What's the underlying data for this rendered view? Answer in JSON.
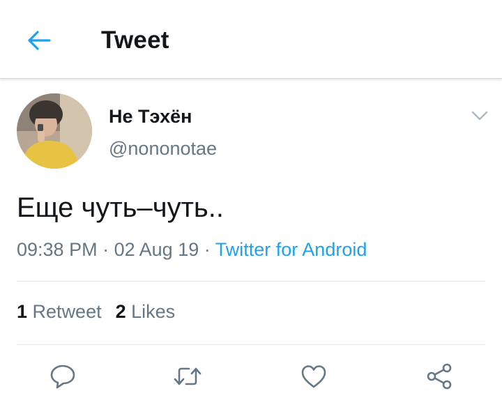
{
  "header": {
    "title": "Tweet",
    "back_icon": "arrow-left-icon",
    "accent_color": "#1da1f2"
  },
  "tweet": {
    "display_name": "Не Тэхён",
    "handle": "@nononotae",
    "text": "Еще чуть–чуть..",
    "time": "09:38 PM",
    "separator": "·",
    "date": "02 Aug 19",
    "source": "Twitter for Android"
  },
  "stats": {
    "retweets_count": "1",
    "retweets_label": "Retweet",
    "likes_count": "2",
    "likes_label": "Likes"
  },
  "actions": [
    "reply-icon",
    "retweet-icon",
    "like-icon",
    "share-icon"
  ],
  "colors": {
    "text": "#14171a",
    "secondary": "#657786",
    "link": "#1da1f2",
    "divider": "#e1e8ed"
  }
}
